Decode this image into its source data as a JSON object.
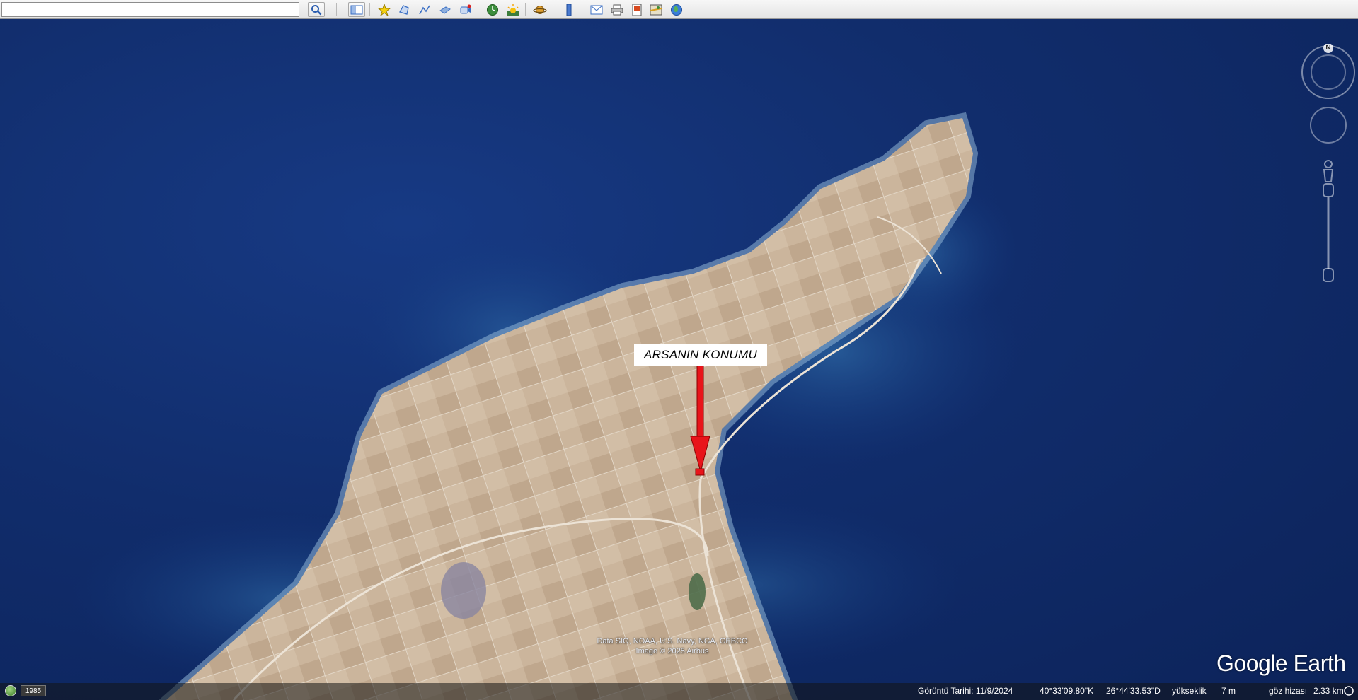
{
  "toolbar": {
    "search": {
      "value": "",
      "placeholder": ""
    },
    "buttons": [
      {
        "name": "search-button",
        "icon": "magnifier-icon"
      },
      {
        "name": "sidebar-toggle-button",
        "icon": "sidebar-icon"
      },
      {
        "name": "add-placemark-button",
        "icon": "placemark-icon"
      },
      {
        "name": "add-polygon-button",
        "icon": "polygon-icon"
      },
      {
        "name": "add-path-button",
        "icon": "path-icon"
      },
      {
        "name": "add-image-overlay-button",
        "icon": "image-overlay-icon"
      },
      {
        "name": "record-tour-button",
        "icon": "record-tour-icon"
      },
      {
        "name": "historical-imagery-button",
        "icon": "clock-icon"
      },
      {
        "name": "sunlight-button",
        "icon": "sun-icon"
      },
      {
        "name": "planets-button",
        "icon": "planet-icon"
      },
      {
        "name": "ruler-button",
        "icon": "ruler-icon"
      },
      {
        "name": "email-button",
        "icon": "envelope-icon"
      },
      {
        "name": "print-button",
        "icon": "printer-icon"
      },
      {
        "name": "save-image-button",
        "icon": "save-image-icon"
      },
      {
        "name": "view-in-maps-button",
        "icon": "map-icon"
      },
      {
        "name": "earth-button",
        "icon": "globe-icon"
      }
    ]
  },
  "map": {
    "callout_label": "ARSANIN KONUMU",
    "attribution_line1": "Data SIO, NOAA, U.S. Navy, NGA, GEBCO",
    "attribution_line2": "Image © 2025 Airbus",
    "logo": "Google Earth",
    "compass_north": "N"
  },
  "status": {
    "year": "1985",
    "imagery_date": "Görüntü Tarihi: 11/9/2024",
    "latitude": "40°33'09.80\"K",
    "longitude": "26°44'33.53\"D",
    "elevation_label": "yükseklik",
    "elevation_value": "7 m",
    "eye_alt_label": "göz hizası",
    "eye_alt_value": "2.33 km"
  },
  "colors": {
    "sea": "#112d6c",
    "land": "#c9b49c",
    "arrow": "#e8141a",
    "toolbar": "#eaeaea"
  }
}
